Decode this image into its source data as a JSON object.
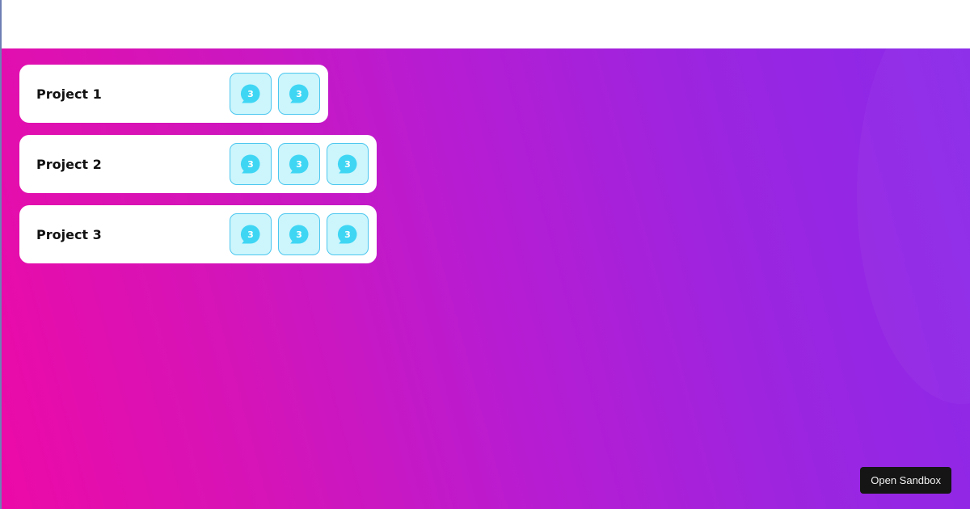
{
  "projects": [
    {
      "title": "Project 1",
      "tiles": [
        {
          "icon": "chat-bubble-icon",
          "count": "3"
        },
        {
          "icon": "chat-bubble-icon",
          "count": "3"
        }
      ]
    },
    {
      "title": "Project 2",
      "tiles": [
        {
          "icon": "chat-bubble-icon",
          "count": "3"
        },
        {
          "icon": "chat-bubble-icon",
          "count": "3"
        },
        {
          "icon": "chat-bubble-icon",
          "count": "3"
        }
      ]
    },
    {
      "title": "Project 3",
      "tiles": [
        {
          "icon": "chat-bubble-icon",
          "count": "3"
        },
        {
          "icon": "chat-bubble-icon",
          "count": "3"
        },
        {
          "icon": "chat-bubble-icon",
          "count": "3"
        }
      ]
    }
  ],
  "sandbox_button": {
    "label": "Open Sandbox"
  },
  "colors": {
    "gradient_start": "#ec0aa7",
    "gradient_end": "#8a29ea",
    "tile_background": "#ccf5fc",
    "tile_border": "#4cc7ef",
    "icon_color": "#3fd6f4"
  }
}
